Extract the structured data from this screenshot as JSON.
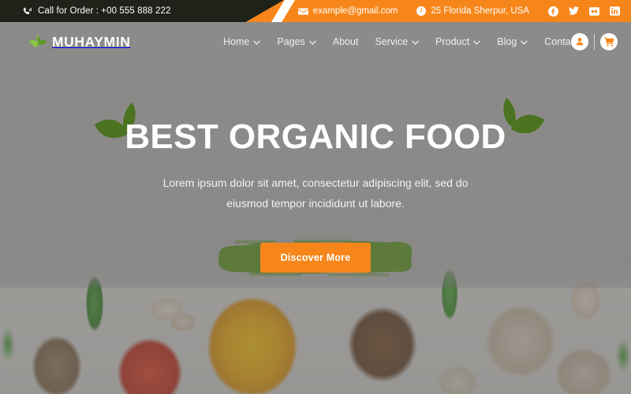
{
  "topbar": {
    "phone_icon": "phone-volume-icon",
    "phone_text": "Call for Order : +00 555 888 222",
    "email_icon": "envelope-icon",
    "email_text": "example@gmail.com",
    "location_icon": "clock-icon",
    "location_text": "25 Florida Sherpur, USA",
    "socials": [
      {
        "name": "facebook-icon",
        "label": "Facebook"
      },
      {
        "name": "twitter-icon",
        "label": "Twitter"
      },
      {
        "name": "flickr-icon",
        "label": "Flickr"
      },
      {
        "name": "linkedin-icon",
        "label": "LinkedIn"
      }
    ],
    "dark_bg": "#1e2219",
    "accent_bg": "#f7861a"
  },
  "header": {
    "logo_icon": "leaf-logo-icon",
    "logo_text": "MUHAYMIN",
    "nav": [
      {
        "label": "Home",
        "dropdown": true
      },
      {
        "label": "Pages",
        "dropdown": true
      },
      {
        "label": "About",
        "dropdown": false
      },
      {
        "label": "Service",
        "dropdown": true
      },
      {
        "label": "Product",
        "dropdown": true
      },
      {
        "label": "Blog",
        "dropdown": true
      },
      {
        "label": "Contact",
        "dropdown": false
      }
    ],
    "account_icon": "user-icon",
    "cart_icon": "shopping-cart-icon"
  },
  "hero": {
    "title": "BEST ORGANIC FOOD",
    "subtitle": "Lorem ipsum dolor sit amet, consectetur adipiscing elit, sed do eiusmod tempor incididunt ut labore.",
    "cta_label": "Discover More",
    "cta_color": "#f7861a",
    "brush_color": "#5d7a3c",
    "leaf_color": "#4b7320",
    "title_color": "#ffffff",
    "overlay_color": "#606060"
  }
}
